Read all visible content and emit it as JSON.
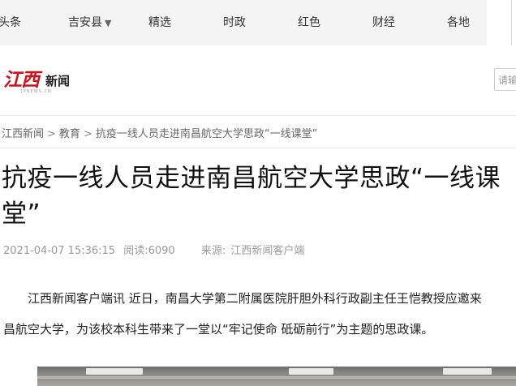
{
  "nav": {
    "items": [
      {
        "label": "头条"
      },
      {
        "label": "吉安县"
      },
      {
        "label": "精选"
      },
      {
        "label": "时政"
      },
      {
        "label": "红色"
      },
      {
        "label": "财经"
      },
      {
        "label": "各地"
      }
    ],
    "dropdown_caret": "▼"
  },
  "logo": {
    "brand_red": "江西",
    "brand_black": "新闻",
    "brand_sub": "JXNEWS.CN"
  },
  "search": {
    "placeholder": "请输"
  },
  "breadcrumb": {
    "items": [
      "江西新闻",
      "教育",
      "抗疫一线人员走进南昌航空大学思政“一线课堂”"
    ],
    "separator": ">"
  },
  "article": {
    "title": "抗疫一线人员走进南昌航空大学思政“一线课堂”",
    "datetime": "2021-04-07 15:36:15",
    "views": "阅读:6090",
    "source_label": "来源:",
    "source": "江西新闻客户端",
    "paragraph_line1": "江西新闻客户端讯  近日，南昌大学第二附属医院肝胆外科行政副主任王恺教授应邀来",
    "paragraph_line2": "昌航空大学，为该校本科生带来了一堂以“牢记使命 砥砺前行”为主题的思政课。"
  },
  "colors": {
    "brand_red": "#d0101b",
    "nav_bg": "#f4f4f4",
    "meta_gray": "#999999"
  }
}
